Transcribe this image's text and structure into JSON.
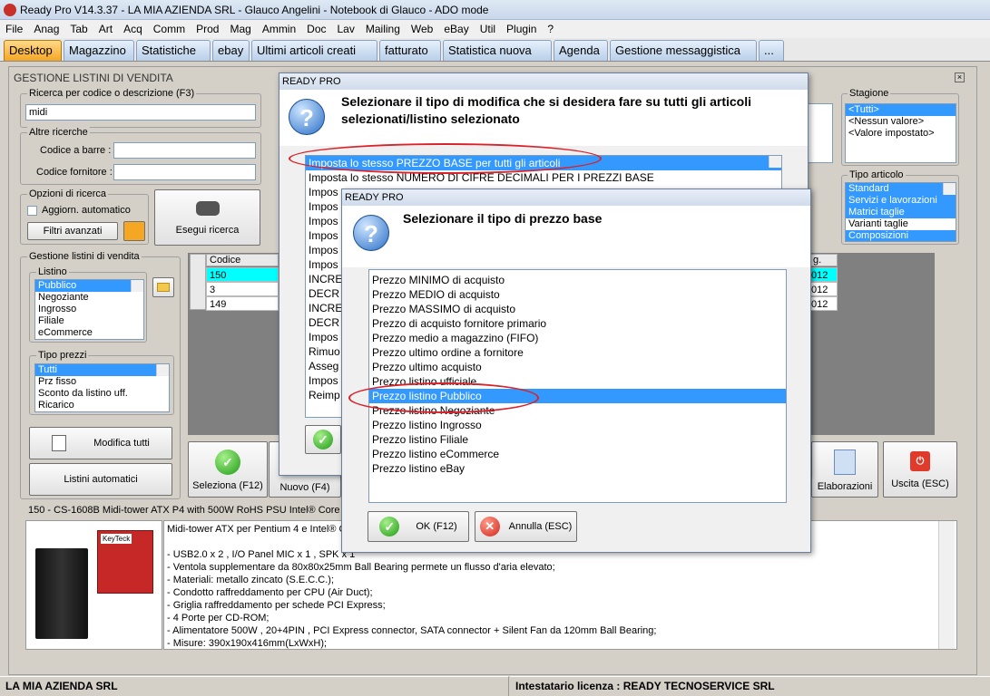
{
  "window": {
    "title": "Ready Pro V14.3.37 - LA MIA AZIENDA SRL - Glauco Angelini - Notebook di Glauco - ADO mode"
  },
  "menu": [
    "File",
    "Anag",
    "Tab",
    "Art",
    "Acq",
    "Comm",
    "Prod",
    "Mag",
    "Ammin",
    "Doc",
    "Lav",
    "Mailing",
    "Web",
    "eBay",
    "Util",
    "Plugin",
    "?"
  ],
  "tabs": [
    "Desktop",
    "Magazzino",
    "Statistiche",
    "ebay",
    "Ultimi articoli creati",
    "fatturato",
    "Statistica nuova",
    "Agenda",
    "Gestione messaggistica",
    "..."
  ],
  "panel": {
    "title": "GESTIONE LISTINI DI VENDITA",
    "search": {
      "legend": "Ricerca per codice o descrizione (F3)",
      "value": "midi"
    },
    "other": {
      "legend": "Altre ricerche",
      "barcode_label": "Codice a barre :",
      "supplier_label": "Codice fornitore :"
    },
    "options": {
      "legend": "Opzioni di ricerca",
      "auto_update": "Aggiorn. automatico",
      "advanced_filters": "Filtri avanzati"
    },
    "search_button": "Esegui ricerca",
    "listini": {
      "legend": "Gestione listini di vendita",
      "sub_legend": "Listino",
      "items": [
        "Pubblico",
        "Negoziante",
        "Ingrosso",
        "Filiale",
        "eCommerce"
      ]
    },
    "prezzi": {
      "legend": "Tipo prezzi",
      "items": [
        "Tutti",
        "Prz fisso",
        "Sconto da listino uff.",
        "Ricarico"
      ]
    },
    "modify_all": "Modifica tutti",
    "auto_lists": "Listini automatici",
    "table": {
      "header": "Codice",
      "rows": [
        "150",
        "3",
        "149"
      ],
      "right_header": "g.",
      "right_rows": [
        "012",
        "012",
        "012"
      ]
    },
    "stagione": {
      "legend": "Stagione",
      "items": [
        "<Tutti>",
        "<Nessun valore>",
        "<Valore impostato>"
      ]
    },
    "tipo_articolo": {
      "legend": "Tipo articolo",
      "items": [
        "Standard",
        "Servizi e lavorazioni",
        "Matrici taglie",
        "Varianti taglie",
        "Composizioni"
      ]
    },
    "buttons": {
      "select": "Seleziona (F12)",
      "new": "Nuovo (F4)",
      "elaborations": "Elaborazioni",
      "exit": "Uscita (ESC)"
    },
    "product_header": "150 - CS-1608B Midi-tower ATX P4 with 500W RoHS PSU Intel® Core 2",
    "product_image_brand": "KeyTeck",
    "product_desc": [
      "Midi-tower ATX per Pentium 4 e Intel® Co",
      "",
      "- USB2.0 x 2 , I/O Panel MIC x 1 , SPK x 1",
      "- Ventola supplementare da 80x80x25mm Ball Bearing permete un flusso d'aria elevato;",
      "- Materiali: metallo zincato (S.E.C.C.);",
      "- Condotto raffreddamento per CPU (Air Duct);",
      "- Griglia raffreddamento per schede PCI Express;",
      "- 4 Porte per CD-ROM;",
      "- Alimentatore 500W , 20+4PIN , PCI Express connector, SATA connector + Silent Fan da 120mm Ball Bearing;",
      "- Misure: 390x190x416mm(LxWxH);"
    ]
  },
  "dialog1": {
    "title": "READY PRO",
    "question": "Selezionare il tipo di modifica che si desidera fare su tutti gli articoli selezionati/listino selezionato",
    "items": [
      "Imposta lo stesso PREZZO BASE per tutti gli articoli",
      "Imposta lo stesso NUMERO DI CIFRE DECIMALI PER I PREZZI BASE",
      "Impos",
      "Impos",
      "Impos",
      "Impos",
      "Impos",
      "Impos",
      "INCRE",
      "DECR",
      "INCRE",
      "DECR",
      "Impos",
      "Rimuo",
      "Asseg",
      "Impos",
      "Reimp"
    ]
  },
  "dialog2": {
    "title": "READY PRO",
    "question": "Selezionare il tipo di prezzo base",
    "items": [
      "Prezzo MINIMO di acquisto",
      "Prezzo MEDIO di acquisto",
      "Prezzo MASSIMO di acquisto",
      "Prezzo di acquisto fornitore primario",
      "Prezzo medio a magazzino (FIFO)",
      "Prezzo ultimo ordine a fornitore",
      "Prezzo ultimo acquisto",
      "Prezzo listino ufficiale",
      "Prezzo listino Pubblico",
      "Prezzo listino Negoziante",
      "Prezzo listino Ingrosso",
      "Prezzo listino Filiale",
      "Prezzo listino eCommerce",
      "Prezzo listino eBay"
    ],
    "ok": "OK (F12)",
    "cancel": "Annulla (ESC)"
  },
  "status": {
    "left": "LA MIA AZIENDA SRL",
    "right": "Intestatario licenza : READY TECNOSERVICE SRL"
  }
}
